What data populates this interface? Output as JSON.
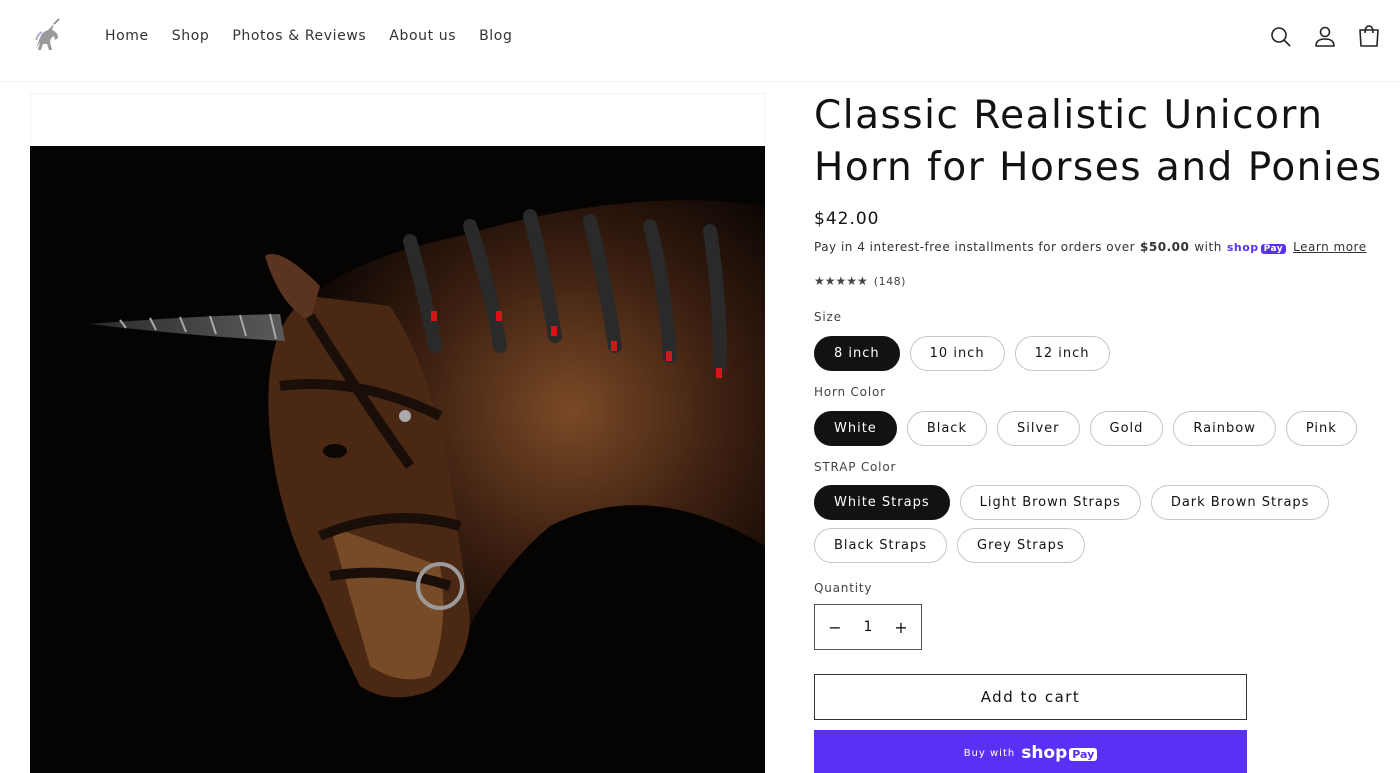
{
  "nav": {
    "items": [
      "Home",
      "Shop",
      "Photos & Reviews",
      "About us",
      "Blog"
    ]
  },
  "header_icons": [
    "search-icon",
    "account-icon",
    "cart-icon"
  ],
  "product": {
    "title": "Classic Realistic Unicorn Horn for Horses and Ponies",
    "price": "$42.00",
    "installments_prefix": "Pay in 4 interest-free installments for orders over",
    "installments_amount": "$50.00",
    "installments_with": "with",
    "shoppay_word": "shop",
    "shoppay_pay": "Pay",
    "learn_more": "Learn more",
    "rating_stars": 5,
    "rating_count": "(148)"
  },
  "options": {
    "size": {
      "label": "Size",
      "values": [
        "8 inch",
        "10 inch",
        "12 inch"
      ],
      "selected": "8 inch"
    },
    "horn_color": {
      "label": "Horn Color",
      "values": [
        "White",
        "Black",
        "Silver",
        "Gold",
        "Rainbow",
        "Pink"
      ],
      "selected": "White"
    },
    "strap_color": {
      "label": "STRAP Color",
      "values": [
        "White Straps",
        "Light Brown Straps",
        "Dark Brown Straps",
        "Black Straps",
        "Grey Straps"
      ],
      "selected": "White Straps"
    }
  },
  "quantity": {
    "label": "Quantity",
    "value": "1",
    "minus": "−",
    "plus": "+"
  },
  "buttons": {
    "add_to_cart": "Add to cart",
    "buy_with": "Buy with",
    "shoppay_word": "shop",
    "shoppay_pay": "Pay"
  },
  "colors": {
    "accent": "#5a31f4",
    "selected_pill": "#121212"
  }
}
